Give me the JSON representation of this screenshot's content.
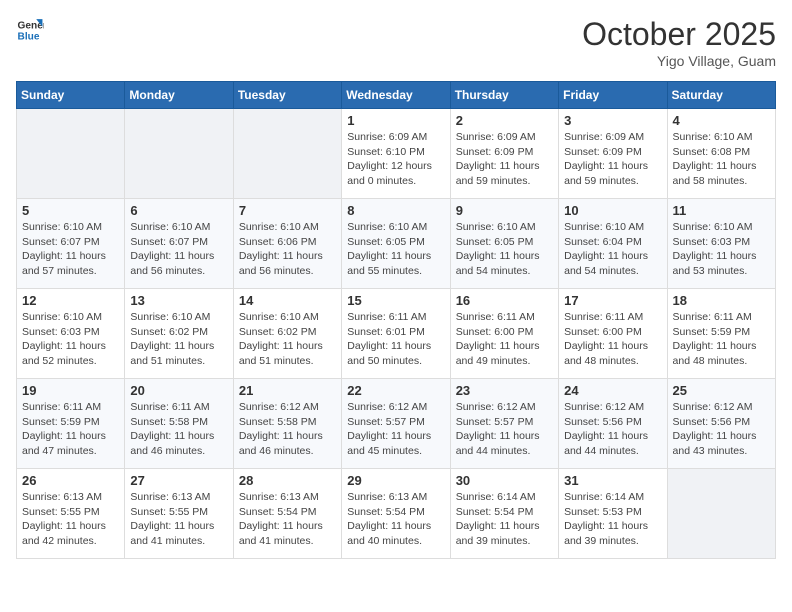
{
  "logo": {
    "line1": "General",
    "line2": "Blue"
  },
  "header": {
    "month": "October 2025",
    "location": "Yigo Village, Guam"
  },
  "weekdays": [
    "Sunday",
    "Monday",
    "Tuesday",
    "Wednesday",
    "Thursday",
    "Friday",
    "Saturday"
  ],
  "weeks": [
    [
      {
        "day": "",
        "info": ""
      },
      {
        "day": "",
        "info": ""
      },
      {
        "day": "",
        "info": ""
      },
      {
        "day": "1",
        "info": "Sunrise: 6:09 AM\nSunset: 6:10 PM\nDaylight: 12 hours\nand 0 minutes."
      },
      {
        "day": "2",
        "info": "Sunrise: 6:09 AM\nSunset: 6:09 PM\nDaylight: 11 hours\nand 59 minutes."
      },
      {
        "day": "3",
        "info": "Sunrise: 6:09 AM\nSunset: 6:09 PM\nDaylight: 11 hours\nand 59 minutes."
      },
      {
        "day": "4",
        "info": "Sunrise: 6:10 AM\nSunset: 6:08 PM\nDaylight: 11 hours\nand 58 minutes."
      }
    ],
    [
      {
        "day": "5",
        "info": "Sunrise: 6:10 AM\nSunset: 6:07 PM\nDaylight: 11 hours\nand 57 minutes."
      },
      {
        "day": "6",
        "info": "Sunrise: 6:10 AM\nSunset: 6:07 PM\nDaylight: 11 hours\nand 56 minutes."
      },
      {
        "day": "7",
        "info": "Sunrise: 6:10 AM\nSunset: 6:06 PM\nDaylight: 11 hours\nand 56 minutes."
      },
      {
        "day": "8",
        "info": "Sunrise: 6:10 AM\nSunset: 6:05 PM\nDaylight: 11 hours\nand 55 minutes."
      },
      {
        "day": "9",
        "info": "Sunrise: 6:10 AM\nSunset: 6:05 PM\nDaylight: 11 hours\nand 54 minutes."
      },
      {
        "day": "10",
        "info": "Sunrise: 6:10 AM\nSunset: 6:04 PM\nDaylight: 11 hours\nand 54 minutes."
      },
      {
        "day": "11",
        "info": "Sunrise: 6:10 AM\nSunset: 6:03 PM\nDaylight: 11 hours\nand 53 minutes."
      }
    ],
    [
      {
        "day": "12",
        "info": "Sunrise: 6:10 AM\nSunset: 6:03 PM\nDaylight: 11 hours\nand 52 minutes."
      },
      {
        "day": "13",
        "info": "Sunrise: 6:10 AM\nSunset: 6:02 PM\nDaylight: 11 hours\nand 51 minutes."
      },
      {
        "day": "14",
        "info": "Sunrise: 6:10 AM\nSunset: 6:02 PM\nDaylight: 11 hours\nand 51 minutes."
      },
      {
        "day": "15",
        "info": "Sunrise: 6:11 AM\nSunset: 6:01 PM\nDaylight: 11 hours\nand 50 minutes."
      },
      {
        "day": "16",
        "info": "Sunrise: 6:11 AM\nSunset: 6:00 PM\nDaylight: 11 hours\nand 49 minutes."
      },
      {
        "day": "17",
        "info": "Sunrise: 6:11 AM\nSunset: 6:00 PM\nDaylight: 11 hours\nand 48 minutes."
      },
      {
        "day": "18",
        "info": "Sunrise: 6:11 AM\nSunset: 5:59 PM\nDaylight: 11 hours\nand 48 minutes."
      }
    ],
    [
      {
        "day": "19",
        "info": "Sunrise: 6:11 AM\nSunset: 5:59 PM\nDaylight: 11 hours\nand 47 minutes."
      },
      {
        "day": "20",
        "info": "Sunrise: 6:11 AM\nSunset: 5:58 PM\nDaylight: 11 hours\nand 46 minutes."
      },
      {
        "day": "21",
        "info": "Sunrise: 6:12 AM\nSunset: 5:58 PM\nDaylight: 11 hours\nand 46 minutes."
      },
      {
        "day": "22",
        "info": "Sunrise: 6:12 AM\nSunset: 5:57 PM\nDaylight: 11 hours\nand 45 minutes."
      },
      {
        "day": "23",
        "info": "Sunrise: 6:12 AM\nSunset: 5:57 PM\nDaylight: 11 hours\nand 44 minutes."
      },
      {
        "day": "24",
        "info": "Sunrise: 6:12 AM\nSunset: 5:56 PM\nDaylight: 11 hours\nand 44 minutes."
      },
      {
        "day": "25",
        "info": "Sunrise: 6:12 AM\nSunset: 5:56 PM\nDaylight: 11 hours\nand 43 minutes."
      }
    ],
    [
      {
        "day": "26",
        "info": "Sunrise: 6:13 AM\nSunset: 5:55 PM\nDaylight: 11 hours\nand 42 minutes."
      },
      {
        "day": "27",
        "info": "Sunrise: 6:13 AM\nSunset: 5:55 PM\nDaylight: 11 hours\nand 41 minutes."
      },
      {
        "day": "28",
        "info": "Sunrise: 6:13 AM\nSunset: 5:54 PM\nDaylight: 11 hours\nand 41 minutes."
      },
      {
        "day": "29",
        "info": "Sunrise: 6:13 AM\nSunset: 5:54 PM\nDaylight: 11 hours\nand 40 minutes."
      },
      {
        "day": "30",
        "info": "Sunrise: 6:14 AM\nSunset: 5:54 PM\nDaylight: 11 hours\nand 39 minutes."
      },
      {
        "day": "31",
        "info": "Sunrise: 6:14 AM\nSunset: 5:53 PM\nDaylight: 11 hours\nand 39 minutes."
      },
      {
        "day": "",
        "info": ""
      }
    ]
  ]
}
